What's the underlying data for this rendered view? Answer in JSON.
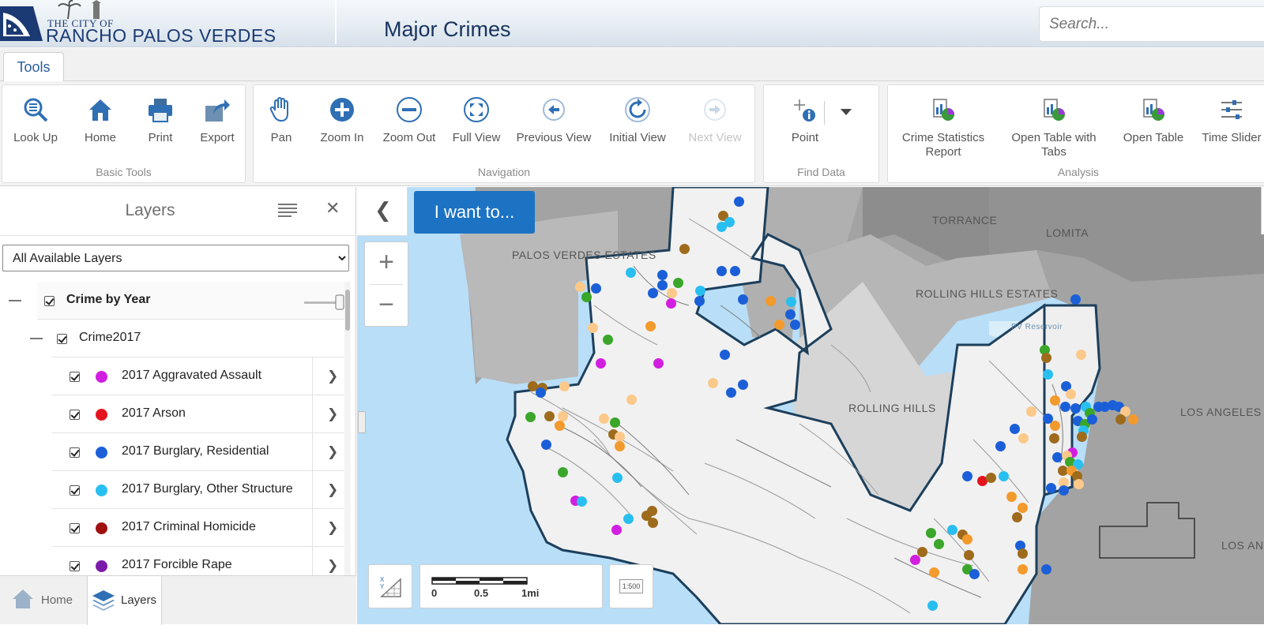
{
  "header": {
    "logo_small": "THE CITY OF",
    "logo_big": "RANCHO PALOS VERDES",
    "app_title": "Major Crimes",
    "search_placeholder": "Search..."
  },
  "tabs": [
    "Tools"
  ],
  "ribbon": {
    "groups": [
      {
        "label": "Basic Tools",
        "tools": [
          {
            "label": "Look Up",
            "icon": "lookup-icon"
          },
          {
            "label": "Home",
            "icon": "home-icon"
          },
          {
            "label": "Print",
            "icon": "print-icon"
          },
          {
            "label": "Export",
            "icon": "export-icon"
          }
        ]
      },
      {
        "label": "Navigation",
        "tools": [
          {
            "label": "Pan",
            "icon": "pan-hand-icon"
          },
          {
            "label": "Zoom In",
            "icon": "zoom-in-icon"
          },
          {
            "label": "Zoom Out",
            "icon": "zoom-out-icon"
          },
          {
            "label": "Full View",
            "icon": "full-view-icon"
          },
          {
            "label": "Previous View",
            "icon": "previous-view-icon"
          },
          {
            "label": "Initial View",
            "icon": "initial-view-icon"
          },
          {
            "label": "Next View",
            "icon": "next-view-icon",
            "disabled": true
          }
        ]
      },
      {
        "label": "Find Data",
        "tools": [
          {
            "label": "Point",
            "icon": "point-identify-icon"
          }
        ]
      },
      {
        "label": "Analysis",
        "tools": [
          {
            "label": "Crime Statistics",
            "label2": "Report",
            "icon": "report-icon"
          },
          {
            "label": "Open Table with",
            "label2": "Tabs",
            "icon": "table-tabs-icon"
          },
          {
            "label": "Open Table",
            "icon": "table-icon"
          },
          {
            "label": "Time Slider",
            "icon": "time-slider-icon"
          }
        ]
      }
    ]
  },
  "panel": {
    "title": "Layers",
    "select_value": "All Available Layers",
    "tree": {
      "group": "Crime by Year",
      "subgroup": "Crime2017",
      "layers": [
        {
          "label": "2017 Aggravated Assault",
          "color": "#d21ee0"
        },
        {
          "label": "2017 Arson",
          "color": "#e4141e"
        },
        {
          "label": "2017 Burglary, Residential",
          "color": "#1b5fd8"
        },
        {
          "label": "2017 Burglary, Other Structure",
          "color": "#28bff0"
        },
        {
          "label": "2017 Criminal Homicide",
          "color": "#a01010"
        },
        {
          "label": "2017 Forcible Rape",
          "color": "#7a1aa8"
        }
      ]
    },
    "bottom_tabs": [
      {
        "label": "Home",
        "icon": "home-tab-icon"
      },
      {
        "label": "Layers",
        "icon": "layers-tab-icon"
      }
    ]
  },
  "map": {
    "i_want_to": "I want to...",
    "labels": {
      "pve": "PALOS VERDES ESTATES",
      "torrance": "TORRANCE",
      "lomita": "LOMITA",
      "rhe": "ROLLING HILLS ESTATES",
      "rh": "ROLLING HILLS",
      "la": "LOS ANGELES",
      "la2": "LOS AN",
      "reservoir": "PV Reservoir"
    },
    "scale": {
      "t0": "0",
      "t1": "0.5",
      "t2": "1mi"
    },
    "scale_button_text": "1:500"
  },
  "colors": {
    "accent": "#1c73c4",
    "title": "#17335e",
    "ocean": "#b9def7",
    "dot_orange": "#f39a2c",
    "dot_peach": "#fcc98a",
    "dot_brown": "#9e6b1c",
    "dot_green": "#3aa62a"
  }
}
